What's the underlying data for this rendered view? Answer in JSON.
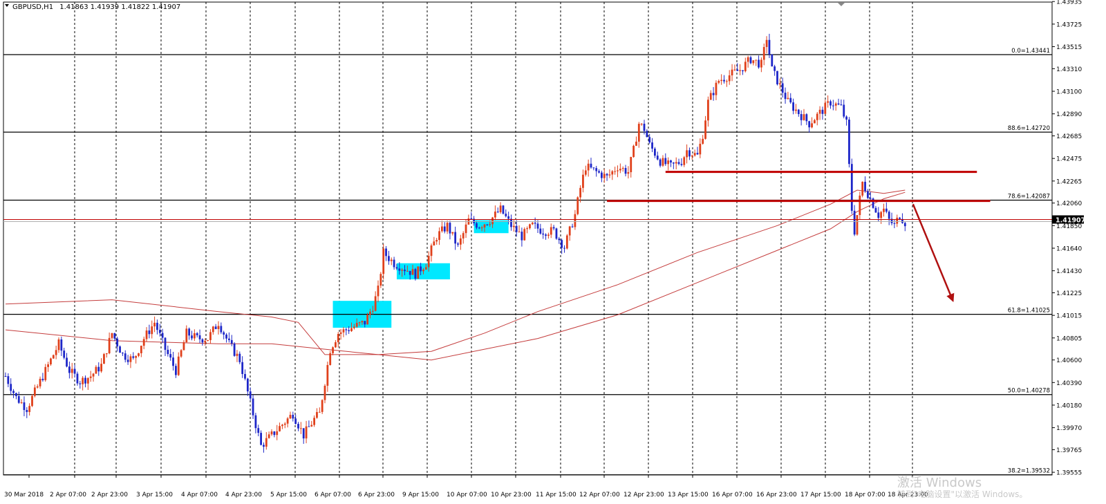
{
  "header": {
    "symbol": "GBPUSD,H1",
    "ohlc": "1.41863 1.41939 1.41822 1.41907"
  },
  "current_price_label": "1.41907",
  "watermark": {
    "line1": "激活 Windows",
    "line2": "转到\"电脑设置\"以激活 Windows。"
  },
  "colors": {
    "bull": "#e0401b",
    "bear": "#1d26c8",
    "ma": "#c43c3c",
    "fib": "#000000",
    "resistance": "#c00000",
    "arrow": "#b01010",
    "highlight": "#00e8ff",
    "price_line": "#c00000"
  },
  "chart_data": {
    "type": "candlestick",
    "title": "GBPUSD,H1",
    "ylim": [
      1.3953,
      1.4393
    ],
    "y_ticks": [
      "1.43935",
      "1.43725",
      "1.43515",
      "1.43310",
      "1.43100",
      "1.42890",
      "1.42685",
      "1.42475",
      "1.42265",
      "1.42060",
      "1.41850",
      "1.41640",
      "1.41430",
      "1.41225",
      "1.41015",
      "1.40805",
      "1.40600",
      "1.40390",
      "1.40180",
      "1.39970",
      "1.39765",
      "1.39555"
    ],
    "x_ticks": [
      "30 Mar 2018",
      "2 Apr 07:00",
      "2 Apr 23:00",
      "3 Apr 15:00",
      "4 Apr 07:00",
      "4 Apr 23:00",
      "5 Apr 15:00",
      "6 Apr 07:00",
      "6 Apr 23:00",
      "9 Apr 15:00",
      "10 Apr 07:00",
      "10 Apr 23:00",
      "11 Apr 15:00",
      "12 Apr 07:00",
      "12 Apr 23:00",
      "13 Apr 15:00",
      "16 Apr 07:00",
      "16 Apr 23:00",
      "17 Apr 15:00",
      "18 Apr 07:00",
      "18 Apr 23:00"
    ],
    "fibonacci": [
      {
        "label": "0.0=1.43441",
        "value": 1.43441
      },
      {
        "label": "88.6=1.42720",
        "value": 1.4272
      },
      {
        "label": "78.6=1.42087",
        "value": 1.42087
      },
      {
        "label": "61.8=1.41025",
        "value": 1.41025
      },
      {
        "label": "50.0=1.40278",
        "value": 1.40278
      },
      {
        "label": "38.2=1.39532",
        "value": 1.39532
      }
    ],
    "current_price": 1.41907,
    "price_path": [
      [
        0,
        1.4045
      ],
      [
        4,
        1.4025
      ],
      [
        8,
        1.4015
      ],
      [
        12,
        1.4035
      ],
      [
        16,
        1.4055
      ],
      [
        20,
        1.4075
      ],
      [
        24,
        1.405
      ],
      [
        28,
        1.404
      ],
      [
        32,
        1.4045
      ],
      [
        36,
        1.4055
      ],
      [
        40,
        1.4085
      ],
      [
        44,
        1.4065
      ],
      [
        48,
        1.406
      ],
      [
        52,
        1.408
      ],
      [
        56,
        1.4095
      ],
      [
        60,
        1.407
      ],
      [
        64,
        1.405
      ],
      [
        68,
        1.4085
      ],
      [
        72,
        1.408
      ],
      [
        76,
        1.408
      ],
      [
        80,
        1.4095
      ],
      [
        84,
        1.4075
      ],
      [
        88,
        1.406
      ],
      [
        92,
        1.402
      ],
      [
        96,
        1.398
      ],
      [
        100,
        1.399
      ],
      [
        104,
        1.4
      ],
      [
        108,
        1.401
      ],
      [
        112,
        1.399
      ],
      [
        116,
        1.4005
      ],
      [
        118,
        1.401
      ],
      [
        120,
        1.404
      ],
      [
        122,
        1.407
      ],
      [
        125,
        1.4085
      ],
      [
        130,
        1.409
      ],
      [
        135,
        1.4095
      ],
      [
        138,
        1.411
      ],
      [
        140,
        1.4125
      ],
      [
        142,
        1.416
      ],
      [
        146,
        1.415
      ],
      [
        150,
        1.4145
      ],
      [
        154,
        1.414
      ],
      [
        158,
        1.415
      ],
      [
        162,
        1.4175
      ],
      [
        166,
        1.4185
      ],
      [
        170,
        1.4165
      ],
      [
        174,
        1.419
      ],
      [
        178,
        1.4185
      ],
      [
        182,
        1.419
      ],
      [
        184,
        1.4195
      ],
      [
        186,
        1.42
      ],
      [
        190,
        1.4185
      ],
      [
        194,
        1.4175
      ],
      [
        198,
        1.4185
      ],
      [
        202,
        1.418
      ],
      [
        206,
        1.418
      ],
      [
        210,
        1.4165
      ],
      [
        214,
        1.4195
      ],
      [
        216,
        1.422
      ],
      [
        218,
        1.424
      ],
      [
        222,
        1.4235
      ],
      [
        226,
        1.423
      ],
      [
        230,
        1.424
      ],
      [
        234,
        1.4235
      ],
      [
        236,
        1.4255
      ],
      [
        238,
        1.428
      ],
      [
        240,
        1.4275
      ],
      [
        242,
        1.426
      ],
      [
        246,
        1.4245
      ],
      [
        250,
        1.424
      ],
      [
        254,
        1.4245
      ],
      [
        256,
        1.4255
      ],
      [
        260,
        1.425
      ],
      [
        262,
        1.427
      ],
      [
        264,
        1.43
      ],
      [
        268,
        1.432
      ],
      [
        272,
        1.4325
      ],
      [
        276,
        1.433
      ],
      [
        280,
        1.434
      ],
      [
        284,
        1.4335
      ],
      [
        286,
        1.436
      ],
      [
        288,
        1.433
      ],
      [
        290,
        1.432
      ],
      [
        294,
        1.43
      ],
      [
        298,
        1.429
      ],
      [
        302,
        1.428
      ],
      [
        306,
        1.429
      ],
      [
        310,
        1.43
      ],
      [
        314,
        1.4295
      ],
      [
        316,
        1.428
      ],
      [
        318,
        1.42
      ],
      [
        319,
        1.418
      ],
      [
        320,
        1.4195
      ],
      [
        322,
        1.4225
      ],
      [
        324,
        1.4215
      ],
      [
        326,
        1.4205
      ],
      [
        328,
        1.4195
      ],
      [
        330,
        1.42
      ],
      [
        332,
        1.419
      ],
      [
        334,
        1.4185
      ],
      [
        336,
        1.4195
      ],
      [
        338,
        1.4188
      ]
    ],
    "moving_averages": [
      {
        "name": "",
        "points": [
          [
            0,
            1.4112
          ],
          [
            40,
            1.4116
          ],
          [
            80,
            1.4105
          ],
          [
            100,
            1.41
          ],
          [
            110,
            1.4095
          ],
          [
            120,
            1.4065
          ],
          [
            140,
            1.4065
          ],
          [
            160,
            1.4068
          ],
          [
            180,
            1.4085
          ],
          [
            200,
            1.4105
          ],
          [
            230,
            1.413
          ],
          [
            260,
            1.416
          ],
          [
            290,
            1.4185
          ],
          [
            310,
            1.4205
          ],
          [
            320,
            1.4218
          ],
          [
            330,
            1.4215
          ],
          [
            338,
            1.4218
          ]
        ]
      },
      {
        "name": "",
        "points": [
          [
            0,
            1.4088
          ],
          [
            40,
            1.4078
          ],
          [
            80,
            1.4075
          ],
          [
            100,
            1.4075
          ],
          [
            120,
            1.407
          ],
          [
            140,
            1.4065
          ],
          [
            160,
            1.406
          ],
          [
            180,
            1.407
          ],
          [
            200,
            1.408
          ],
          [
            230,
            1.4102
          ],
          [
            260,
            1.4132
          ],
          [
            290,
            1.4162
          ],
          [
            310,
            1.4182
          ],
          [
            320,
            1.4198
          ],
          [
            330,
            1.421
          ],
          [
            338,
            1.4216
          ]
        ]
      }
    ],
    "resistance_lines": [
      {
        "from_bar": 248,
        "to_bar": 365,
        "value": 1.4235
      },
      {
        "from_bar": 226,
        "to_bar": 370,
        "value": 1.4208
      }
    ],
    "highlight_zones": [
      {
        "from_bar": 123,
        "to_bar": 145,
        "low": 1.409,
        "high": 1.4115
      },
      {
        "from_bar": 147,
        "to_bar": 167,
        "low": 1.4135,
        "high": 1.415
      },
      {
        "from_bar": 176,
        "to_bar": 189,
        "low": 1.4178,
        "high": 1.419
      }
    ],
    "forecast_arrow": {
      "from_bar": 341,
      "from_value": 1.4205,
      "to_bar": 356,
      "to_value": 1.4115
    }
  }
}
